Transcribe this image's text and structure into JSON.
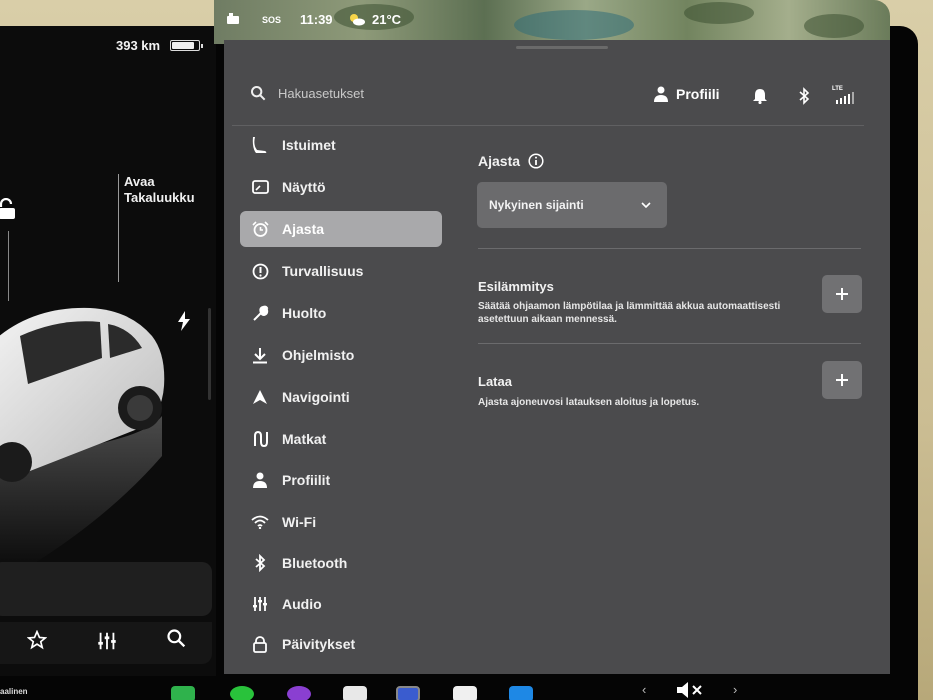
{
  "car": {
    "range": "393 km",
    "battery_level": 0.85,
    "trunk_label": "Avaa\nTakaluukku"
  },
  "status": {
    "sos": "SOS",
    "time": "11:39",
    "temp": "21°C"
  },
  "search": {
    "placeholder": "Hakuasetukset"
  },
  "header": {
    "profile_label": "Profiili",
    "lte": "LTE"
  },
  "nav": {
    "items": [
      {
        "label": "Istuimet",
        "icon": "seat-icon"
      },
      {
        "label": "Näyttö",
        "icon": "display-icon"
      },
      {
        "label": "Ajasta",
        "icon": "alarm-clock-icon",
        "active": true
      },
      {
        "label": "Turvallisuus",
        "icon": "alert-circle-icon"
      },
      {
        "label": "Huolto",
        "icon": "wrench-icon"
      },
      {
        "label": "Ohjelmisto",
        "icon": "download-icon"
      },
      {
        "label": "Navigointi",
        "icon": "navigation-icon"
      },
      {
        "label": "Matkat",
        "icon": "trips-icon"
      },
      {
        "label": "Profiilit",
        "icon": "person-icon"
      },
      {
        "label": "Wi-Fi",
        "icon": "wifi-icon"
      },
      {
        "label": "Bluetooth",
        "icon": "bluetooth-icon"
      },
      {
        "label": "Audio",
        "icon": "equalizer-icon"
      },
      {
        "label": "Päivitykset",
        "icon": "lock-icon"
      }
    ]
  },
  "schedule": {
    "title": "Ajasta",
    "location_value": "Nykyinen sijainti",
    "preheat": {
      "title": "Esilämmitys",
      "desc": "Säätää ohjaamon lämpötilaa ja lämmittää akkua automaattisesti asetettuun aikaan mennessä."
    },
    "charge": {
      "title": "Lataa",
      "desc": "Ajasta ajoneuvosi latauksen aloitus ja lopetus."
    }
  },
  "taskbar": {
    "label": "aalinen"
  },
  "colors": {
    "panel_bg": "#4b4b4d",
    "active_nav_bg": "#a9a9ab",
    "button_bg": "#717173",
    "select_bg": "#6b6b6d"
  }
}
